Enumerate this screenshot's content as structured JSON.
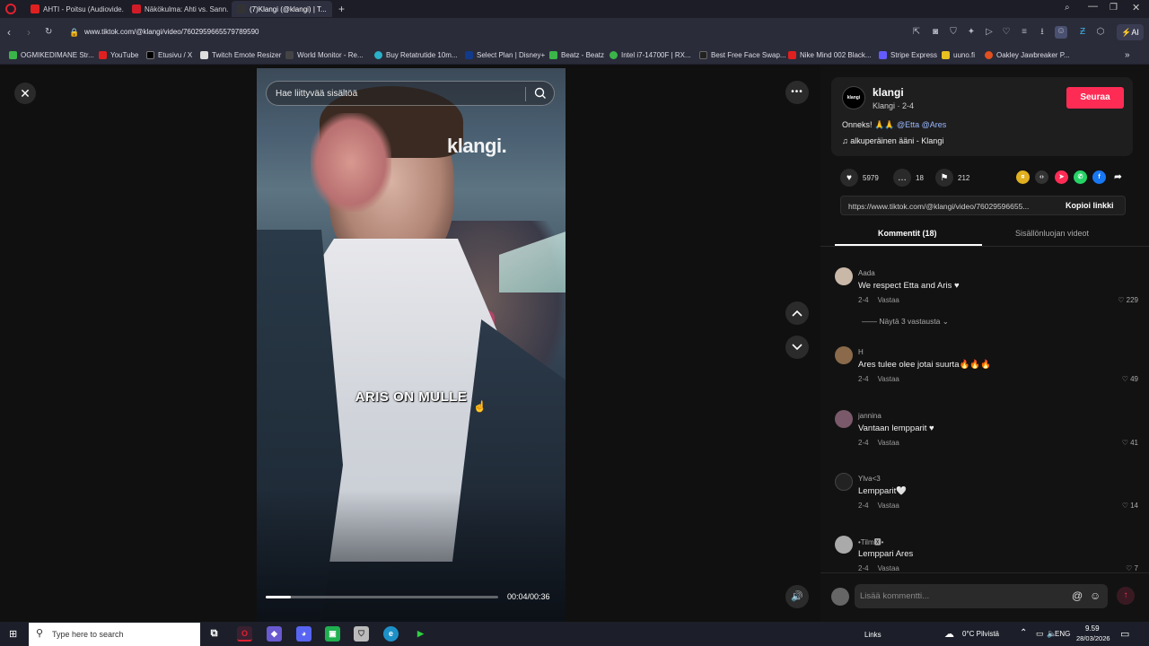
{
  "browser": {
    "tabs": [
      {
        "label": "AHTI - Poitsu (Audiovide...",
        "color": "#e02020"
      },
      {
        "label": "Näkökulma: Ahti vs. Sann...",
        "color": "#d01c28"
      },
      {
        "label": "(7)Klangi (@klangi) | T...",
        "color": "#222"
      }
    ],
    "url": "www.tiktok.com/@klangi/video/7602959665579789590",
    "extension_label": "AI",
    "bookmarks": [
      {
        "label": "OGMIKEDIMANE Str...",
        "color": "#3bb54a"
      },
      {
        "label": "YouTube",
        "color": "#e02020"
      },
      {
        "label": "Etusivu / X",
        "color": "#000"
      },
      {
        "label": "Twitch Emote Resizer",
        "color": "#ddd"
      },
      {
        "label": "World Monitor - Re...",
        "color": "#444"
      },
      {
        "label": "Buy Retatrutide 10m...",
        "color": "#2ab0c8"
      },
      {
        "label": "Select Plan | Disney+",
        "color": "#123a8a"
      },
      {
        "label": "Beatz - Beatz",
        "color": "#3bb54a"
      },
      {
        "label": "Intel i7-14700F | RX...",
        "color": "#3bb54a"
      },
      {
        "label": "Best Free Face Swap...",
        "color": "#222"
      },
      {
        "label": "Nike Mind 002 Black...",
        "color": "#e02020"
      },
      {
        "label": "Stripe Express",
        "color": "#635bff"
      },
      {
        "label": "uuno.fi",
        "color": "#e8c020"
      },
      {
        "label": "Oakley Jawbreaker P...",
        "color": "#e05020"
      }
    ]
  },
  "video": {
    "search_placeholder": "Hae liittyvää sisältöä",
    "watermark": "klangi.",
    "caption": "ARIS ON MULLE",
    "progress": 0.11,
    "time": "00:04/00:36"
  },
  "panel": {
    "author_avatar_text": "klangi",
    "author_name": "klangi",
    "author_sub": "Klangi · 2-4",
    "follow_label": "Seuraa",
    "description_prefix": "Onneks! 🙏🙏 ",
    "description_mentions": "@Etta @Ares",
    "sound": "♫  alkuperäinen ääni - Klangi",
    "likes": "5979",
    "comments": "18",
    "saves": "212",
    "link": "https://www.tiktok.com/@klangi/video/76029596655...",
    "copy_label": "Kopioi linkki",
    "tab_comments": "Kommentit (18)",
    "tab_creator": "Sisällönluojan videot",
    "more_replies": "Näytä 3 vastausta",
    "comment_placeholder": "Lisää kommentti...",
    "comment_list": [
      {
        "user": "Aada",
        "text": "We respect Etta and Aris ♥",
        "date": "2-4",
        "reply": "Vastaa",
        "likes": "229",
        "color": "#c9b8a8"
      },
      {
        "user": "H",
        "text": "Ares tulee olee jotai suurta🔥🔥🔥",
        "date": "2-4",
        "reply": "Vastaa",
        "likes": "49",
        "color": "#8a6a4a"
      },
      {
        "user": "jannina",
        "text": "Vantaan lempparit ♥",
        "date": "2-4",
        "reply": "Vastaa",
        "likes": "41",
        "color": "#7a5a6a"
      },
      {
        "user": "Ylva<3",
        "text": "Lempparit🤍",
        "date": "2-4",
        "reply": "Vastaa",
        "likes": "14",
        "color": "#222"
      },
      {
        "user": "•Tilm🆇•",
        "text": "Lemppari Ares",
        "date": "2-4",
        "reply": "Vastaa",
        "likes": "7",
        "color": "#aaa"
      }
    ]
  },
  "taskbar": {
    "search_placeholder": "Type here to search",
    "links_label": "Links",
    "weather": "0°C  Pilvistä",
    "language": "ENG",
    "time": "9.59",
    "date": "28/03/2026"
  }
}
